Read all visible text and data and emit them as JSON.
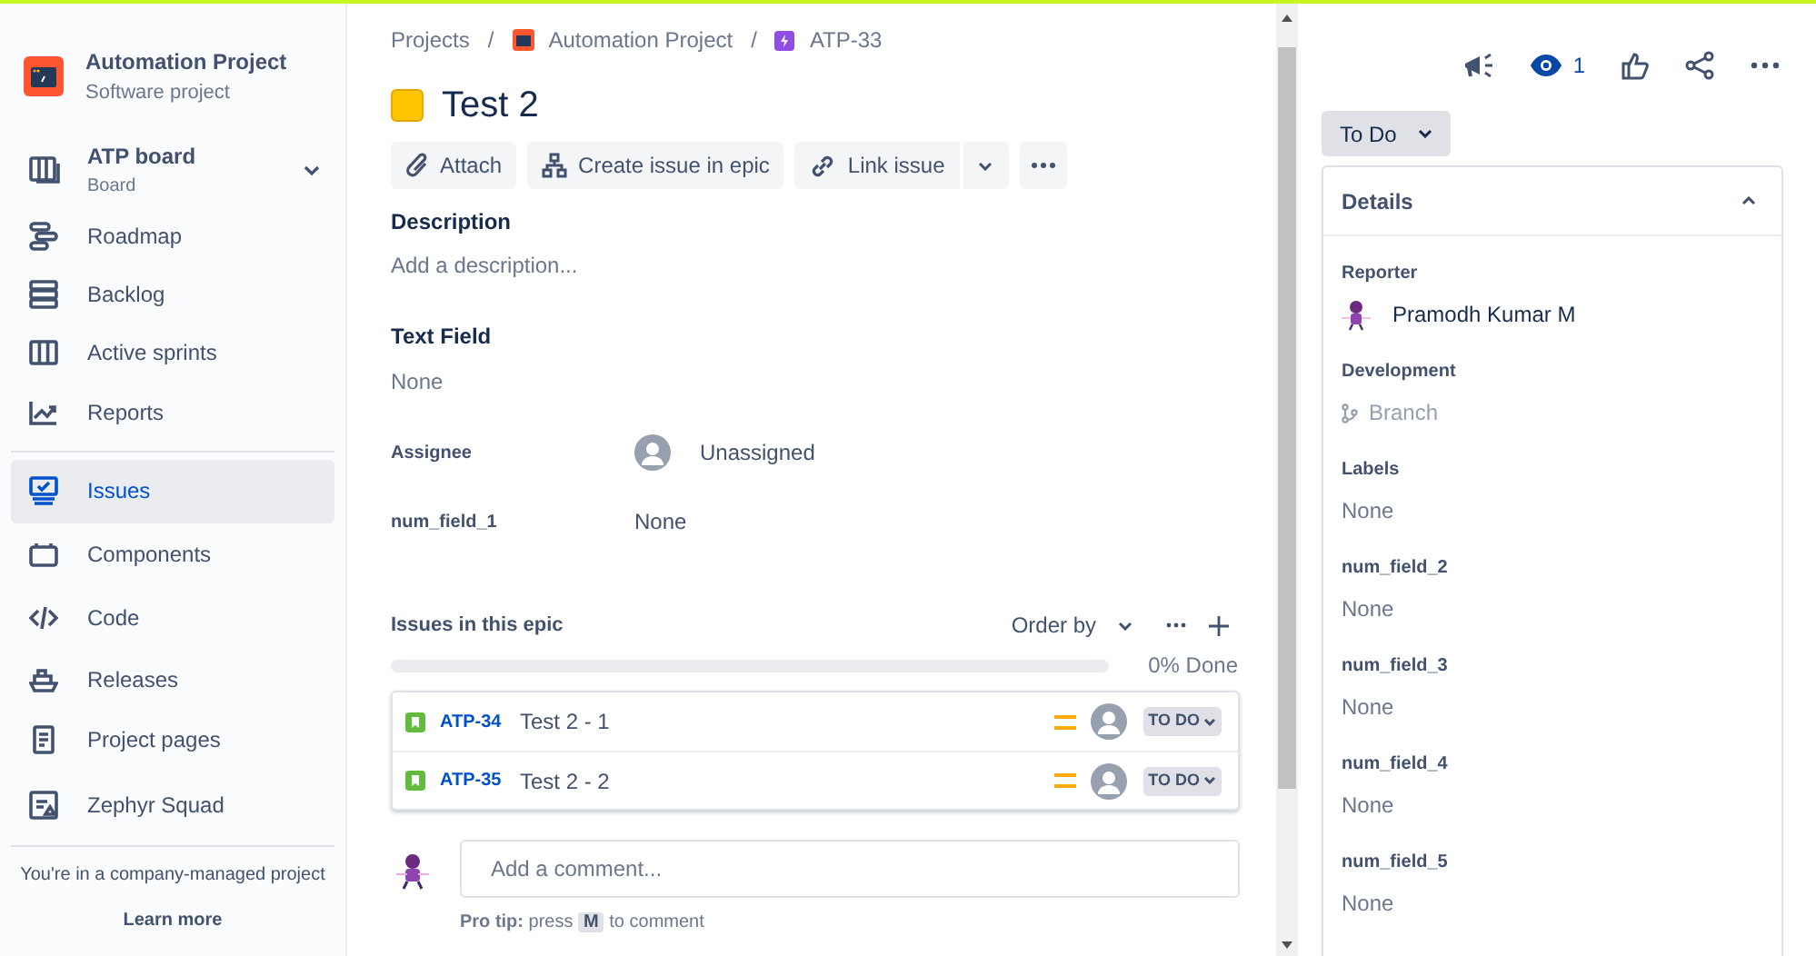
{
  "project": {
    "name": "Automation Project",
    "type": "Software project"
  },
  "sidebar": {
    "board": {
      "name": "ATP board",
      "sub": "Board"
    },
    "items": [
      {
        "label": "Roadmap",
        "selected": false
      },
      {
        "label": "Backlog",
        "selected": false
      },
      {
        "label": "Active sprints",
        "selected": false
      },
      {
        "label": "Reports",
        "selected": false
      },
      {
        "label": "Issues",
        "selected": true
      },
      {
        "label": "Components",
        "selected": false
      },
      {
        "label": "Code",
        "selected": false
      },
      {
        "label": "Releases",
        "selected": false
      },
      {
        "label": "Project pages",
        "selected": false
      },
      {
        "label": "Zephyr Squad",
        "selected": false
      }
    ],
    "footer": {
      "text": "You're in a company-managed project",
      "link": "Learn more"
    }
  },
  "breadcrumbs": [
    "Projects",
    "Automation Project",
    "ATP-33"
  ],
  "breadcrumb_separator": "/",
  "issue": {
    "title": "Test 2",
    "toolbar": [
      "Attach",
      "Create issue in epic",
      "Link issue"
    ],
    "description": {
      "label": "Description",
      "placeholder": "Add a description..."
    },
    "text_field": {
      "label": "Text Field",
      "value": "None"
    },
    "inline_fields": [
      {
        "label": "Assignee",
        "value": "Unassigned",
        "kind": "user"
      },
      {
        "label": "num_field_1",
        "value": "None",
        "kind": "text"
      }
    ],
    "epic": {
      "title": "Issues in this epic",
      "order_by": "Order by",
      "level": 0,
      "reading": "0% Done",
      "issues": [
        {
          "key": "ATP-34",
          "summary": "Test 2 - 1",
          "status": "TO DO"
        },
        {
          "key": "ATP-35",
          "summary": "Test 2 - 2",
          "status": "TO DO"
        }
      ]
    },
    "comment": {
      "placeholder": "Add a comment...",
      "tip_label": "Pro tip:",
      "tip_before": "press",
      "tip_key": "M",
      "tip_after": "to comment"
    }
  },
  "right": {
    "watchers": "1",
    "status": "To Do",
    "details": {
      "title": "Details",
      "expanded": true,
      "fields": [
        {
          "label": "Reporter",
          "value": "Pramodh Kumar M",
          "kind": "user"
        },
        {
          "label": "Development",
          "value": "Branch",
          "kind": "branch"
        },
        {
          "label": "Labels",
          "value": "None",
          "kind": "text"
        },
        {
          "label": "num_field_2",
          "value": "None",
          "kind": "text"
        },
        {
          "label": "num_field_3",
          "value": "None",
          "kind": "text"
        },
        {
          "label": "num_field_4",
          "value": "None",
          "kind": "text"
        },
        {
          "label": "num_field_5",
          "value": "None",
          "kind": "text"
        }
      ]
    }
  }
}
